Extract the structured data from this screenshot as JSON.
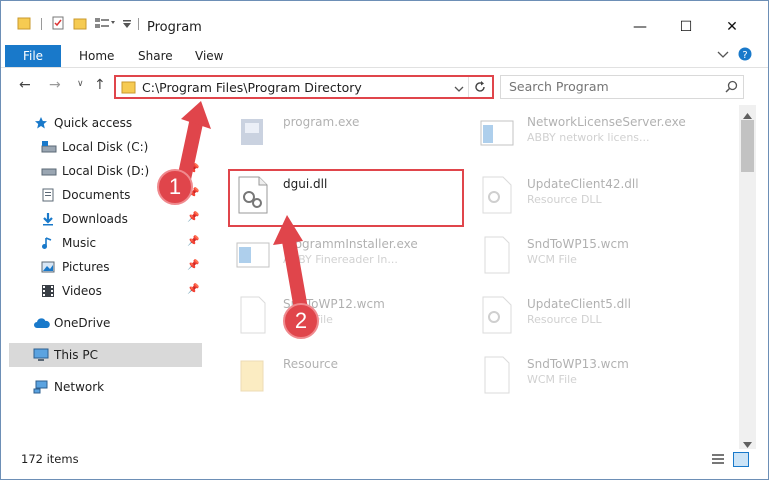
{
  "window": {
    "title": "Program"
  },
  "title_buttons": {
    "minimize": "—",
    "maximize": "☐",
    "close": "✕"
  },
  "ribbon": {
    "file_tab": "File",
    "tabs": [
      "Home",
      "Share",
      "View"
    ]
  },
  "address": {
    "path": "C:\\Program Files\\Program Directory"
  },
  "search": {
    "placeholder": "Search Program"
  },
  "nav": {
    "items": [
      {
        "label": "Quick access",
        "icon": "star-icon"
      },
      {
        "label": "Local Disk (C:)",
        "icon": "drive-icon"
      },
      {
        "label": "Local Disk (D:)",
        "icon": "drive-icon"
      },
      {
        "label": "Documents",
        "icon": "documents-icon"
      },
      {
        "label": "Downloads",
        "icon": "download-icon"
      },
      {
        "label": "Music",
        "icon": "music-icon"
      },
      {
        "label": "Pictures",
        "icon": "pictures-icon"
      },
      {
        "label": "Videos",
        "icon": "videos-icon"
      },
      {
        "label": "OneDrive",
        "icon": "cloud-icon"
      },
      {
        "label": "This PC",
        "icon": "computer-icon"
      },
      {
        "label": "Network",
        "icon": "network-icon"
      }
    ]
  },
  "files": [
    {
      "name": "program.exe",
      "desc": ""
    },
    {
      "name": "NetworkLicenseServer.exe",
      "desc": "ABBY network licens..."
    },
    {
      "name": "dgui.dll",
      "desc": ""
    },
    {
      "name": "UpdateClient42.dll",
      "desc": "Resource DLL"
    },
    {
      "name": "ProgrammInstaller.exe",
      "desc": "ABBY Finereader In..."
    },
    {
      "name": "SndToWP15.wcm",
      "desc": "WCM File"
    },
    {
      "name": "SndToWP12.wcm",
      "desc": "WCM File"
    },
    {
      "name": "UpdateClient5.dll",
      "desc": "Resource DLL"
    },
    {
      "name": "Resource",
      "desc": ""
    },
    {
      "name": "SndToWP13.wcm",
      "desc": "WCM File"
    }
  ],
  "status": {
    "count": "172 items"
  },
  "annotations": {
    "step1": "1",
    "step2": "2"
  },
  "colors": {
    "accent": "#1979ca",
    "highlight": "#e0454b"
  }
}
